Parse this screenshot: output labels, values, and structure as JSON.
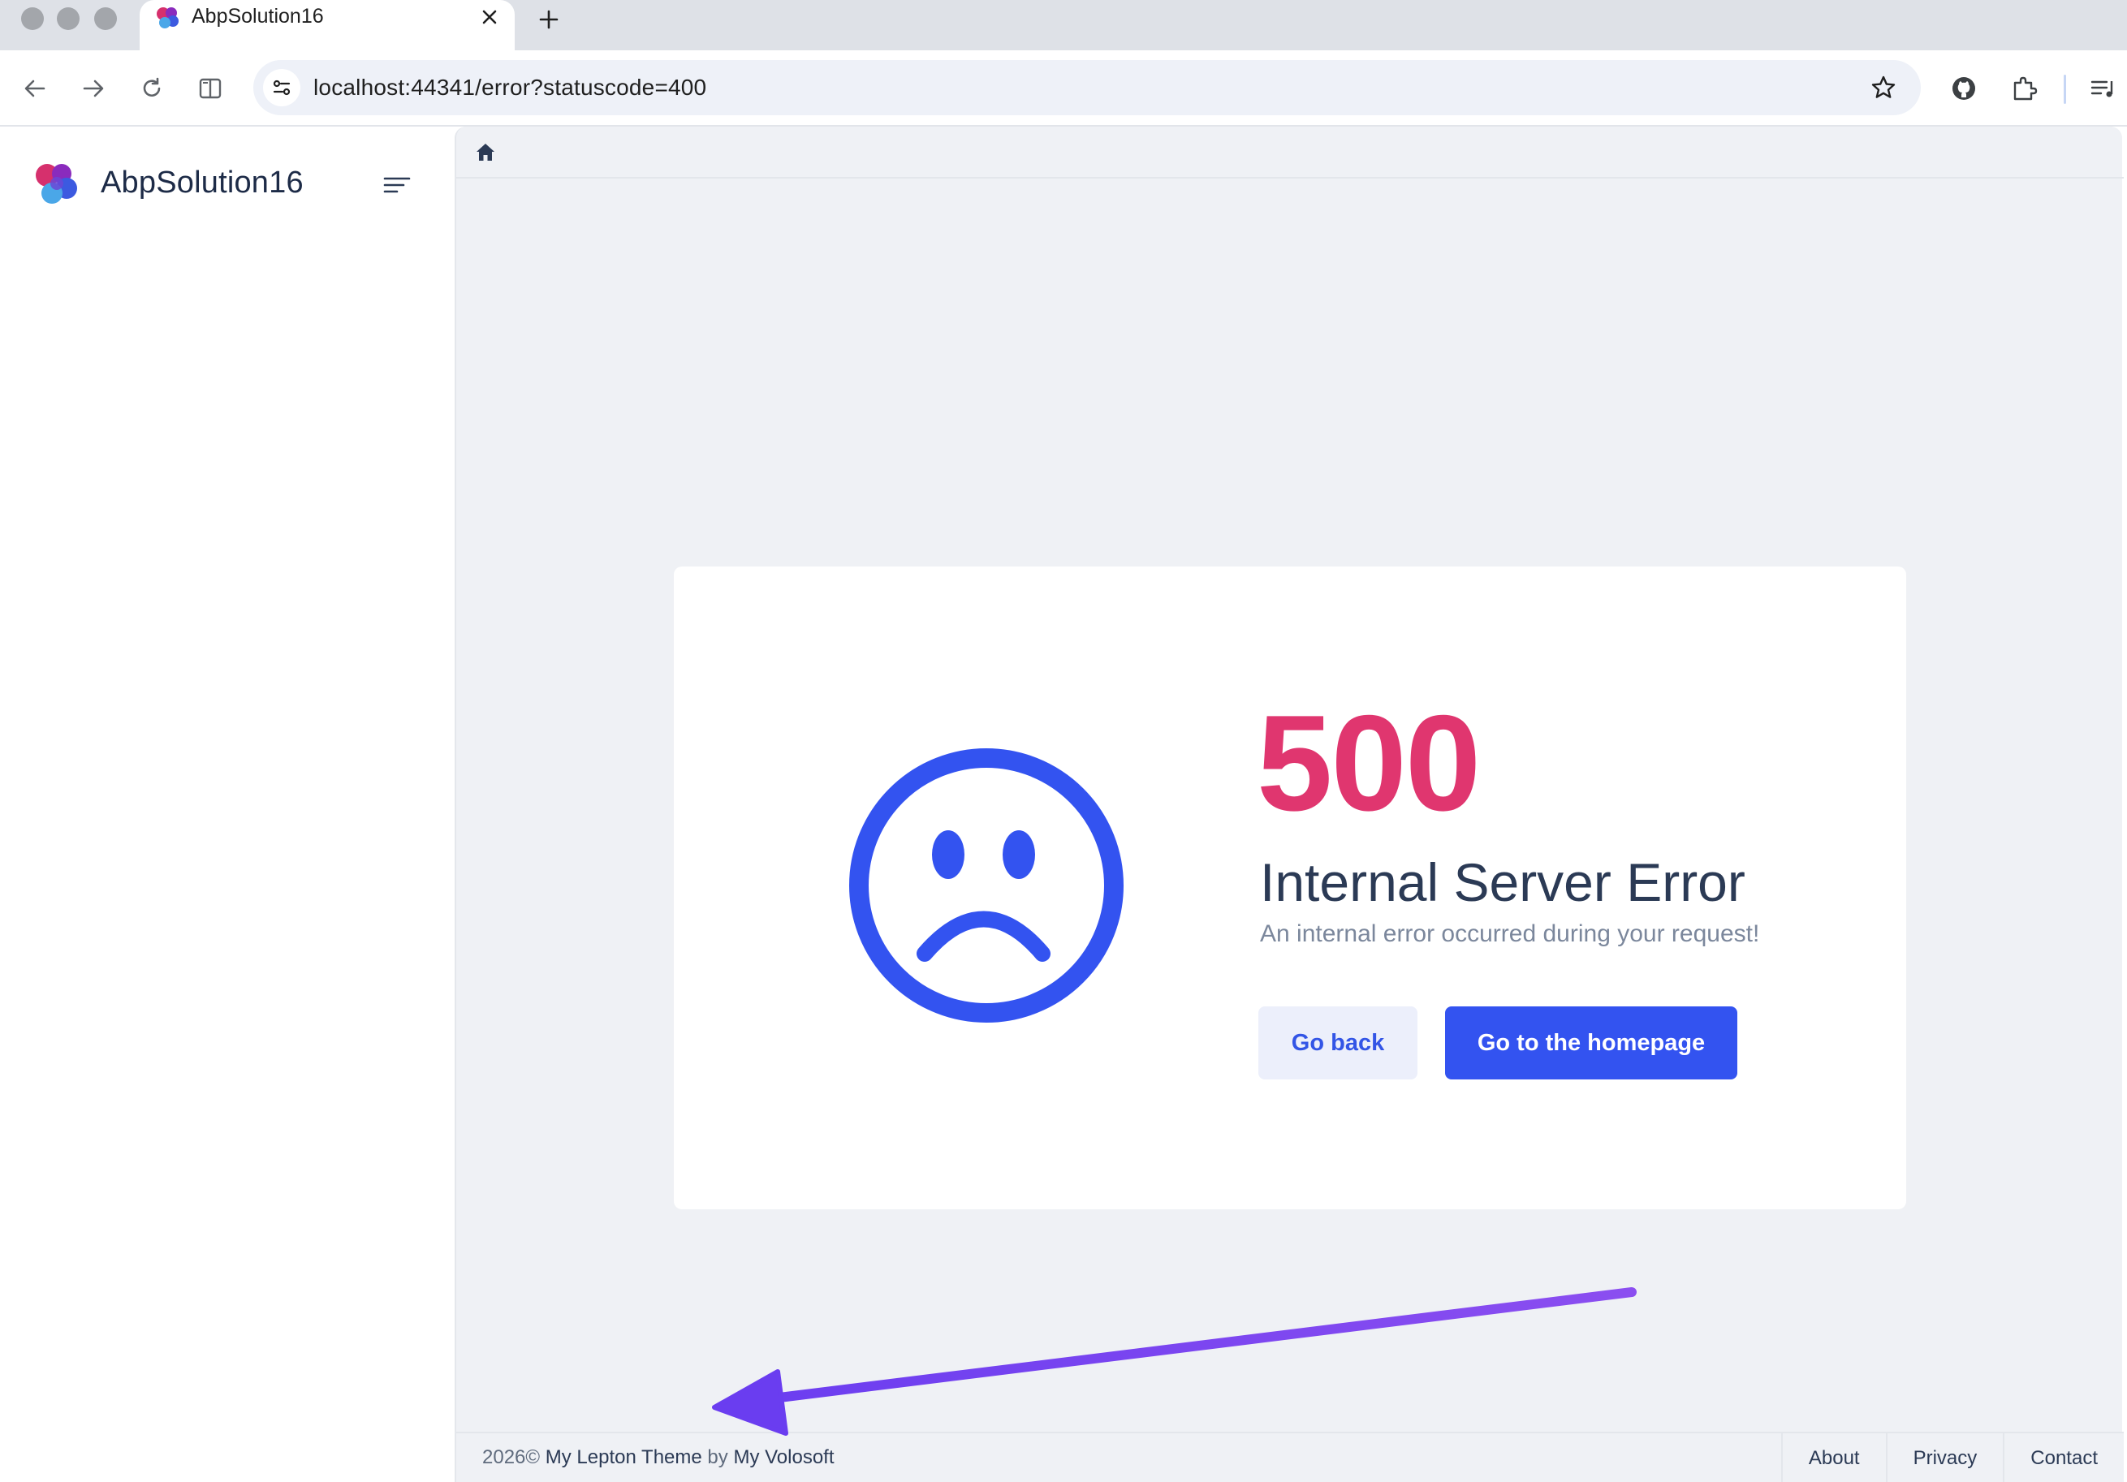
{
  "browser": {
    "tab_title": "AbpSolution16",
    "url": "localhost:44341/error?statuscode=400"
  },
  "app": {
    "brand": "AbpSolution16"
  },
  "error": {
    "code": "500",
    "title": "Internal Server Error",
    "description": "An internal error occurred during your request!",
    "back_label": "Go back",
    "home_label": "Go to the homepage"
  },
  "footer": {
    "year": "2026©",
    "theme": "My Lepton Theme",
    "by": "by",
    "company": "My Volosoft",
    "links": [
      "About",
      "Privacy",
      "Contact"
    ]
  },
  "colors": {
    "accent": "#3353f0",
    "error_code": "#e0366f",
    "annotation_arrow": "#7c4dff"
  },
  "icons": [
    "back-arrow-icon",
    "forward-arrow-icon",
    "reload-icon",
    "split-view-icon",
    "site-info-icon",
    "star-icon",
    "github-icon",
    "extensions-icon",
    "media-icon",
    "menu-toggle-icon",
    "home-icon",
    "sad-face-icon"
  ]
}
